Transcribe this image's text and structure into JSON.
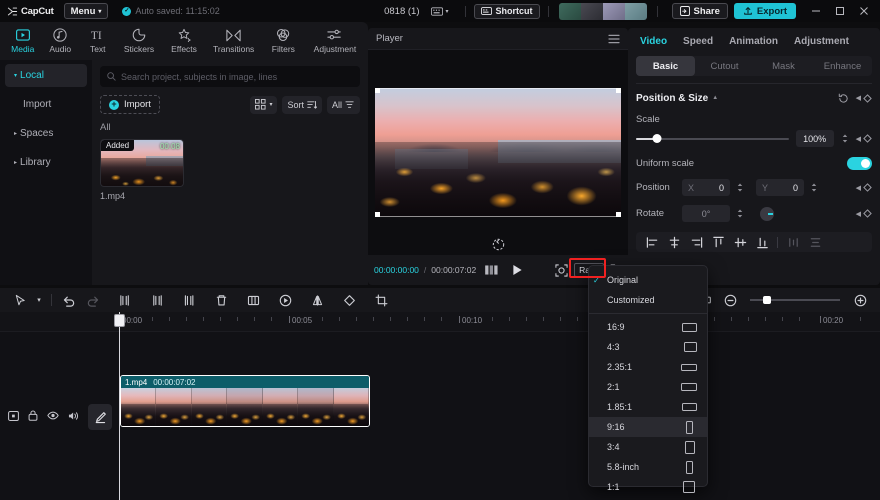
{
  "titlebar": {
    "brand": "CapCut",
    "menu_label": "Menu",
    "autosave_text": "Auto saved: 11:15:02",
    "project_name": "0818 (1)",
    "shortcut_label": "Shortcut",
    "share_label": "Share",
    "export_label": "Export",
    "accent": "#1fc3d4",
    "minimize": "–",
    "maximize": "□",
    "close": "✕"
  },
  "tabs": [
    {
      "label": "Media",
      "icon": "media-icon",
      "active": true
    },
    {
      "label": "Audio",
      "icon": "audio-icon",
      "active": false
    },
    {
      "label": "Text",
      "icon": "text-icon",
      "active": false
    },
    {
      "label": "Stickers",
      "icon": "stickers-icon",
      "active": false
    },
    {
      "label": "Effects",
      "icon": "effects-icon",
      "active": false
    },
    {
      "label": "Transitions",
      "icon": "transitions-icon",
      "active": false
    },
    {
      "label": "Filters",
      "icon": "filters-icon",
      "active": false
    },
    {
      "label": "Adjustment",
      "icon": "adjustment-icon",
      "active": false
    }
  ],
  "leftnav": [
    {
      "label": "Local",
      "active": true,
      "caret": "▾",
      "sub": false
    },
    {
      "label": "Import",
      "active": false,
      "caret": "",
      "sub": true
    },
    {
      "label": "Spaces",
      "active": false,
      "caret": "▸",
      "sub": false
    },
    {
      "label": "Library",
      "active": false,
      "caret": "▸",
      "sub": false
    }
  ],
  "media": {
    "search_placeholder": "Search project, subjects in image, lines",
    "search_value": "",
    "import_label": "Import",
    "sort_label": "Sort",
    "filter_label": "All",
    "group_label": "All",
    "item": {
      "badge": "Added",
      "duration": "00:08",
      "name": "1.mp4"
    }
  },
  "player": {
    "title": "Player",
    "current_time": "00:00:00:00",
    "separator": "/",
    "total_time": "00:00:07:02",
    "ratio_button": "Ratio"
  },
  "ratio_menu": {
    "selected": "Original",
    "highlighted": "9:16",
    "items": [
      {
        "label": "Original",
        "shape": "none",
        "w": 0,
        "h": 0
      },
      {
        "label": "Customized",
        "shape": "none",
        "w": 0,
        "h": 0
      },
      {
        "label": "16:9",
        "shape": "rect",
        "w": 15,
        "h": 9
      },
      {
        "label": "4:3",
        "shape": "rect",
        "w": 13,
        "h": 10
      },
      {
        "label": "2.35:1",
        "shape": "rect",
        "w": 16,
        "h": 7
      },
      {
        "label": "2:1",
        "shape": "rect",
        "w": 16,
        "h": 8
      },
      {
        "label": "1.85:1",
        "shape": "rect",
        "w": 15,
        "h": 8
      },
      {
        "label": "9:16",
        "shape": "rect",
        "w": 7,
        "h": 13
      },
      {
        "label": "3:4",
        "shape": "rect",
        "w": 10,
        "h": 13
      },
      {
        "label": "5.8-inch",
        "shape": "rect",
        "w": 7,
        "h": 13
      },
      {
        "label": "1:1",
        "shape": "rect",
        "w": 12,
        "h": 12
      }
    ]
  },
  "properties": {
    "tabs": [
      {
        "label": "Video",
        "active": true
      },
      {
        "label": "Speed",
        "active": false
      },
      {
        "label": "Animation",
        "active": false
      },
      {
        "label": "Adjustment",
        "active": false
      }
    ],
    "segments": [
      {
        "label": "Basic",
        "active": true
      },
      {
        "label": "Cutout",
        "active": false
      },
      {
        "label": "Mask",
        "active": false
      },
      {
        "label": "Enhance",
        "active": false
      }
    ],
    "section_title": "Position & Size",
    "scale_label": "Scale",
    "scale_value": "100%",
    "uniform_scale_label": "Uniform scale",
    "uniform_scale_on": true,
    "position_label": "Position",
    "position_x_tag": "X",
    "position_x_value": "0",
    "position_y_tag": "Y",
    "position_y_value": "0",
    "rotate_label": "Rotate",
    "rotate_value": "0°",
    "align_icons": [
      "align-left-icon",
      "align-center-horizontal-icon",
      "align-right-icon",
      "align-top-icon",
      "align-middle-vertical-icon",
      "align-bottom-icon",
      "distribute-horizontal-icon",
      "distribute-vertical-icon"
    ]
  },
  "timeline_toolbar": {
    "icons": [
      "select-tool-icon",
      "undo-icon",
      "redo-icon",
      "split-icon",
      "trim-left-icon",
      "trim-right-icon",
      "delete-icon",
      "crop-clip-icon",
      "freeze-frame-icon",
      "mirror-icon",
      "rotate-clip-icon",
      "crop-icon"
    ],
    "right_icons": [
      "link-clips-icon",
      "split-track-icon",
      "zoom-out-icon",
      "zoom-in-icon"
    ]
  },
  "timeline": {
    "ruler_labels": [
      "00:00",
      "00:05",
      "00:10",
      "00:20"
    ],
    "track_icons": [
      "track-type-icon",
      "lock-icon",
      "eye-icon",
      "volume-icon"
    ],
    "edit_icon": "pencil-icon",
    "clip": {
      "name": "1.mp4",
      "duration": "00:00:07:02",
      "color": "#0d5d69"
    },
    "playhead_time": "00:00"
  }
}
